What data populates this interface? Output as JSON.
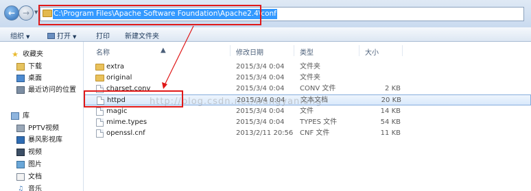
{
  "address": {
    "path": "C:\\Program Files\\Apache Software Foundation\\Apache2.4\\conf"
  },
  "toolbar": {
    "organize": "组织",
    "open": "打开",
    "print": "打印",
    "new_folder": "新建文件夹"
  },
  "sidebar": {
    "items": [
      {
        "label": "收藏夹",
        "icon": "star-icon"
      },
      {
        "label": "下载",
        "icon": "download-folder-icon"
      },
      {
        "label": "桌面",
        "icon": "desktop-icon"
      },
      {
        "label": "最近访问的位置",
        "icon": "recent-places-icon"
      },
      {
        "label": "库",
        "icon": "library-icon"
      },
      {
        "label": "PPTV视频",
        "icon": "pptv-icon"
      },
      {
        "label": "暴风影视库",
        "icon": "video-library-icon"
      },
      {
        "label": "视频",
        "icon": "video-icon"
      },
      {
        "label": "图片",
        "icon": "pictures-icon"
      },
      {
        "label": "文档",
        "icon": "documents-icon"
      },
      {
        "label": "音乐",
        "icon": "music-icon"
      }
    ]
  },
  "columns": {
    "name": "名称",
    "date": "修改日期",
    "type": "类型",
    "size": "大小"
  },
  "files": [
    {
      "name": "extra",
      "date": "2015/3/4 0:04",
      "type": "文件夹",
      "size": "",
      "icon": "folder-icon"
    },
    {
      "name": "original",
      "date": "2015/3/4 0:04",
      "type": "文件夹",
      "size": "",
      "icon": "folder-icon"
    },
    {
      "name": "charset.conv",
      "date": "2015/3/4 0:04",
      "type": "CONV 文件",
      "size": "2 KB",
      "icon": "file-icon"
    },
    {
      "name": "httpd",
      "date": "2015/3/4 0:04",
      "type": "文本文档",
      "size": "20 KB",
      "icon": "text-file-icon"
    },
    {
      "name": "magic",
      "date": "2015/3/4 0:04",
      "type": "文件",
      "size": "14 KB",
      "icon": "file-icon"
    },
    {
      "name": "mime.types",
      "date": "2015/3/4 0:04",
      "type": "TYPES 文件",
      "size": "54 KB",
      "icon": "file-icon"
    },
    {
      "name": "openssl.cnf",
      "date": "2013/2/11 20:56",
      "type": "CNF 文件",
      "size": "11 KB",
      "icon": "file-icon"
    }
  ],
  "watermark": "http://blog.csdn.net/wangyanlong",
  "colors": {
    "selection_border": "#84acdd",
    "annotation_red": "#e01818",
    "address_highlight": "#3399ff"
  }
}
